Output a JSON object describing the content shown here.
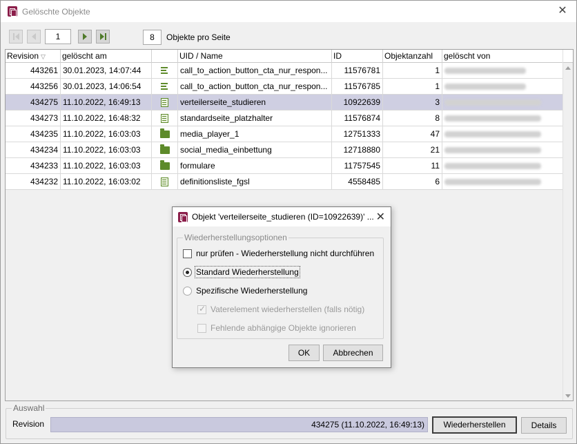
{
  "window": {
    "title": "Gelöschte Objekte",
    "close_glyph": "✕"
  },
  "pager": {
    "page": "1",
    "per_page": "8",
    "per_page_label": "Objekte pro Seite"
  },
  "table": {
    "headers": [
      "Revision",
      "gelöscht am",
      "",
      "UID / Name",
      "ID",
      "Objektanzahl",
      "gelöscht von"
    ],
    "sort_glyph": "▽",
    "rows": [
      {
        "revision": "443261",
        "date": "30.01.2023, 14:07:44",
        "icon": "lines-icon",
        "uid": "call_to_action_button_cta_nur_respon...",
        "id": "11576781",
        "count": "1",
        "by": "[blurred]",
        "selected": false
      },
      {
        "revision": "443256",
        "date": "30.01.2023, 14:06:54",
        "icon": "lines-icon",
        "uid": "call_to_action_button_cta_nur_respon...",
        "id": "11576785",
        "count": "1",
        "by": "[blurred]",
        "selected": false
      },
      {
        "revision": "434275",
        "date": "11.10.2022, 16:49:13",
        "icon": "document-icon",
        "uid": "verteilerseite_studieren",
        "id": "10922639",
        "count": "3",
        "by": "[blurred]",
        "selected": true
      },
      {
        "revision": "434273",
        "date": "11.10.2022, 16:48:32",
        "icon": "document-icon",
        "uid": "standardseite_platzhalter",
        "id": "11576874",
        "count": "8",
        "by": "[blurred]",
        "selected": false
      },
      {
        "revision": "434235",
        "date": "11.10.2022, 16:03:03",
        "icon": "folder-icon",
        "uid": "media_player_1",
        "id": "12751333",
        "count": "47",
        "by": "[blurred]",
        "selected": false
      },
      {
        "revision": "434234",
        "date": "11.10.2022, 16:03:03",
        "icon": "folder-icon",
        "uid": "social_media_einbettung",
        "id": "12718880",
        "count": "21",
        "by": "[blurred]",
        "selected": false
      },
      {
        "revision": "434233",
        "date": "11.10.2022, 16:03:03",
        "icon": "folder-icon",
        "uid": "formulare",
        "id": "11757545",
        "count": "11",
        "by": "[blurred]",
        "selected": false
      },
      {
        "revision": "434232",
        "date": "11.10.2022, 16:03:02",
        "icon": "document-icon",
        "uid": "definitionsliste_fgsl",
        "id": "4558485",
        "count": "6",
        "by": "[blurred]",
        "selected": false
      }
    ]
  },
  "auswahl": {
    "legend": "Auswahl",
    "revision_label": "Revision",
    "revision_value": "434275 (11.10.2022, 16:49:13)",
    "restore_button": "Wiederherstellen",
    "details_button": "Details"
  },
  "dialog": {
    "title": "Objekt 'verteilerseite_studieren (ID=10922639)' ...",
    "close_glyph": "✕",
    "legend": "Wiederherstellungsoptionen",
    "option_check_only": "nur prüfen - Wiederherstellung nicht durchführen",
    "option_standard": "Standard Wiederherstellung",
    "option_specific": "Spezifische Wiederherstellung",
    "sub_parent": "Vaterelement wiederherstellen (falls nötig)",
    "sub_ignore": "Fehlende abhängige Objekte ignorieren",
    "ok_button": "OK",
    "cancel_button": "Abbrechen"
  },
  "colors": {
    "accent": "#8b1e4a",
    "icon_green": "#5d8a2a",
    "selection": "#cfcfe2"
  }
}
